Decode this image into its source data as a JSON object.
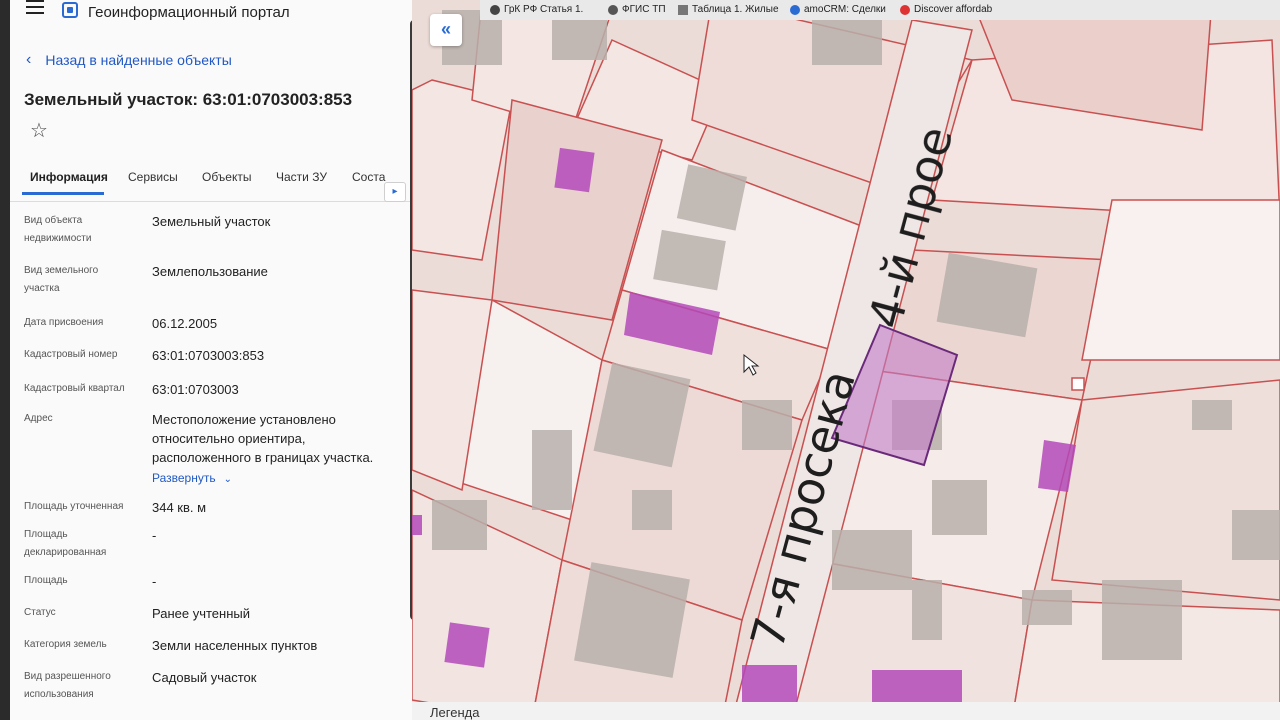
{
  "header": {
    "title": "Геоинформационный портал"
  },
  "nav": {
    "back_label": "Назад в найденные объекты"
  },
  "object": {
    "title": "Земельный участок: 63:01:0703003:853"
  },
  "tabs": [
    "Информация",
    "Сервисы",
    "Объекты",
    "Части ЗУ",
    "Соста"
  ],
  "fields": [
    {
      "label": "Вид объекта недвижимости",
      "value": "Земельный участок"
    },
    {
      "label": "Вид земельного участка",
      "value": "Землепользование"
    },
    {
      "label": "Дата присвоения",
      "value": "06.12.2005"
    },
    {
      "label": "Кадастровый номер",
      "value": "63:01:0703003:853"
    },
    {
      "label": "Кадастровый квартал",
      "value": "63:01:0703003"
    },
    {
      "label": "Адрес",
      "value": "Местоположение установлено относительно ориентира, расположенного в границах участка."
    },
    {
      "label": "Площадь уточненная",
      "value": "344 кв. м"
    },
    {
      "label": "Площадь декларированная",
      "value": "-"
    },
    {
      "label": "Площадь",
      "value": "-"
    },
    {
      "label": "Статус",
      "value": "Ранее учтенный"
    },
    {
      "label": "Категория земель",
      "value": "Земли населенных пунктов"
    },
    {
      "label": "Вид разрешенного использования",
      "value": "Садовый участок"
    }
  ],
  "expand_label": "Развернуть",
  "bookmarks": [
    "ГрК РФ Статья 1.",
    "ФГИС ТП",
    "Таблица 1. Жилые",
    "amoCRM: Сделки",
    "Discover affordab"
  ],
  "map": {
    "streets": [
      "7-я просека",
      "4-й прое"
    ],
    "legend_label": "Легенда",
    "colors": {
      "background": "#ecdcd8",
      "parcel_line": "#c85050",
      "building": "#b9b0ac",
      "selected": "#c17bc6",
      "highlight": "#b44aba"
    }
  }
}
